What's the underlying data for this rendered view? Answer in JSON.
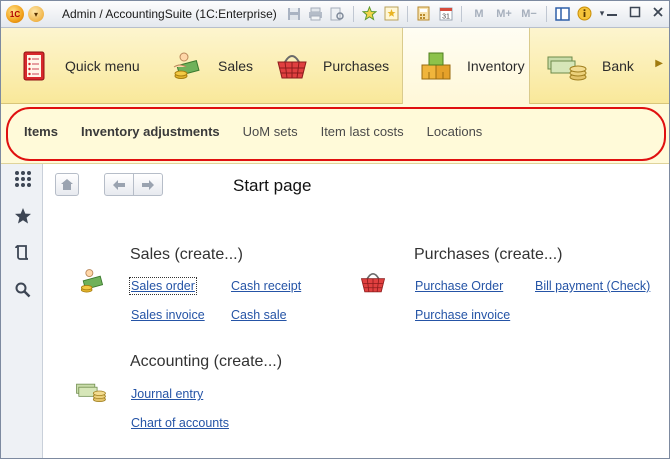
{
  "titlebar": {
    "logo_text": "1C",
    "title": "Admin / AccountingSuite   (1C:Enterprise)",
    "memory_buttons": [
      "M",
      "M+",
      "M−"
    ]
  },
  "sections": [
    {
      "label": "Quick menu",
      "icon": "quick-menu-icon"
    },
    {
      "label": "Sales",
      "icon": "sales-icon"
    },
    {
      "label": "Purchases",
      "icon": "purchases-basket-icon"
    },
    {
      "label": "Inventory",
      "icon": "inventory-boxes-icon",
      "active": true
    },
    {
      "label": "Bank",
      "icon": "bank-money-icon"
    }
  ],
  "functions": [
    {
      "label": "Items",
      "bold": true
    },
    {
      "label": "Inventory adjustments",
      "bold": true
    },
    {
      "label": "UoM sets",
      "bold": false
    },
    {
      "label": "Item last costs",
      "bold": false
    },
    {
      "label": "Locations",
      "bold": false
    }
  ],
  "content": {
    "page_title": "Start page",
    "sales": {
      "title": "Sales (create...)",
      "links": [
        "Sales order",
        "Cash receipt",
        "Sales invoice",
        "Cash sale"
      ]
    },
    "purchases": {
      "title": "Purchases (create...)",
      "links": [
        "Purchase Order",
        "Bill payment (Check)",
        "Purchase invoice"
      ]
    },
    "accounting": {
      "title": "Accounting (create...)",
      "links": [
        "Journal entry",
        "Chart of accounts"
      ]
    }
  },
  "colors": {
    "section_bg": "#f9e89a",
    "function_bg": "#fffad9",
    "highlight_outline": "#e01010",
    "link": "#2554a6"
  }
}
